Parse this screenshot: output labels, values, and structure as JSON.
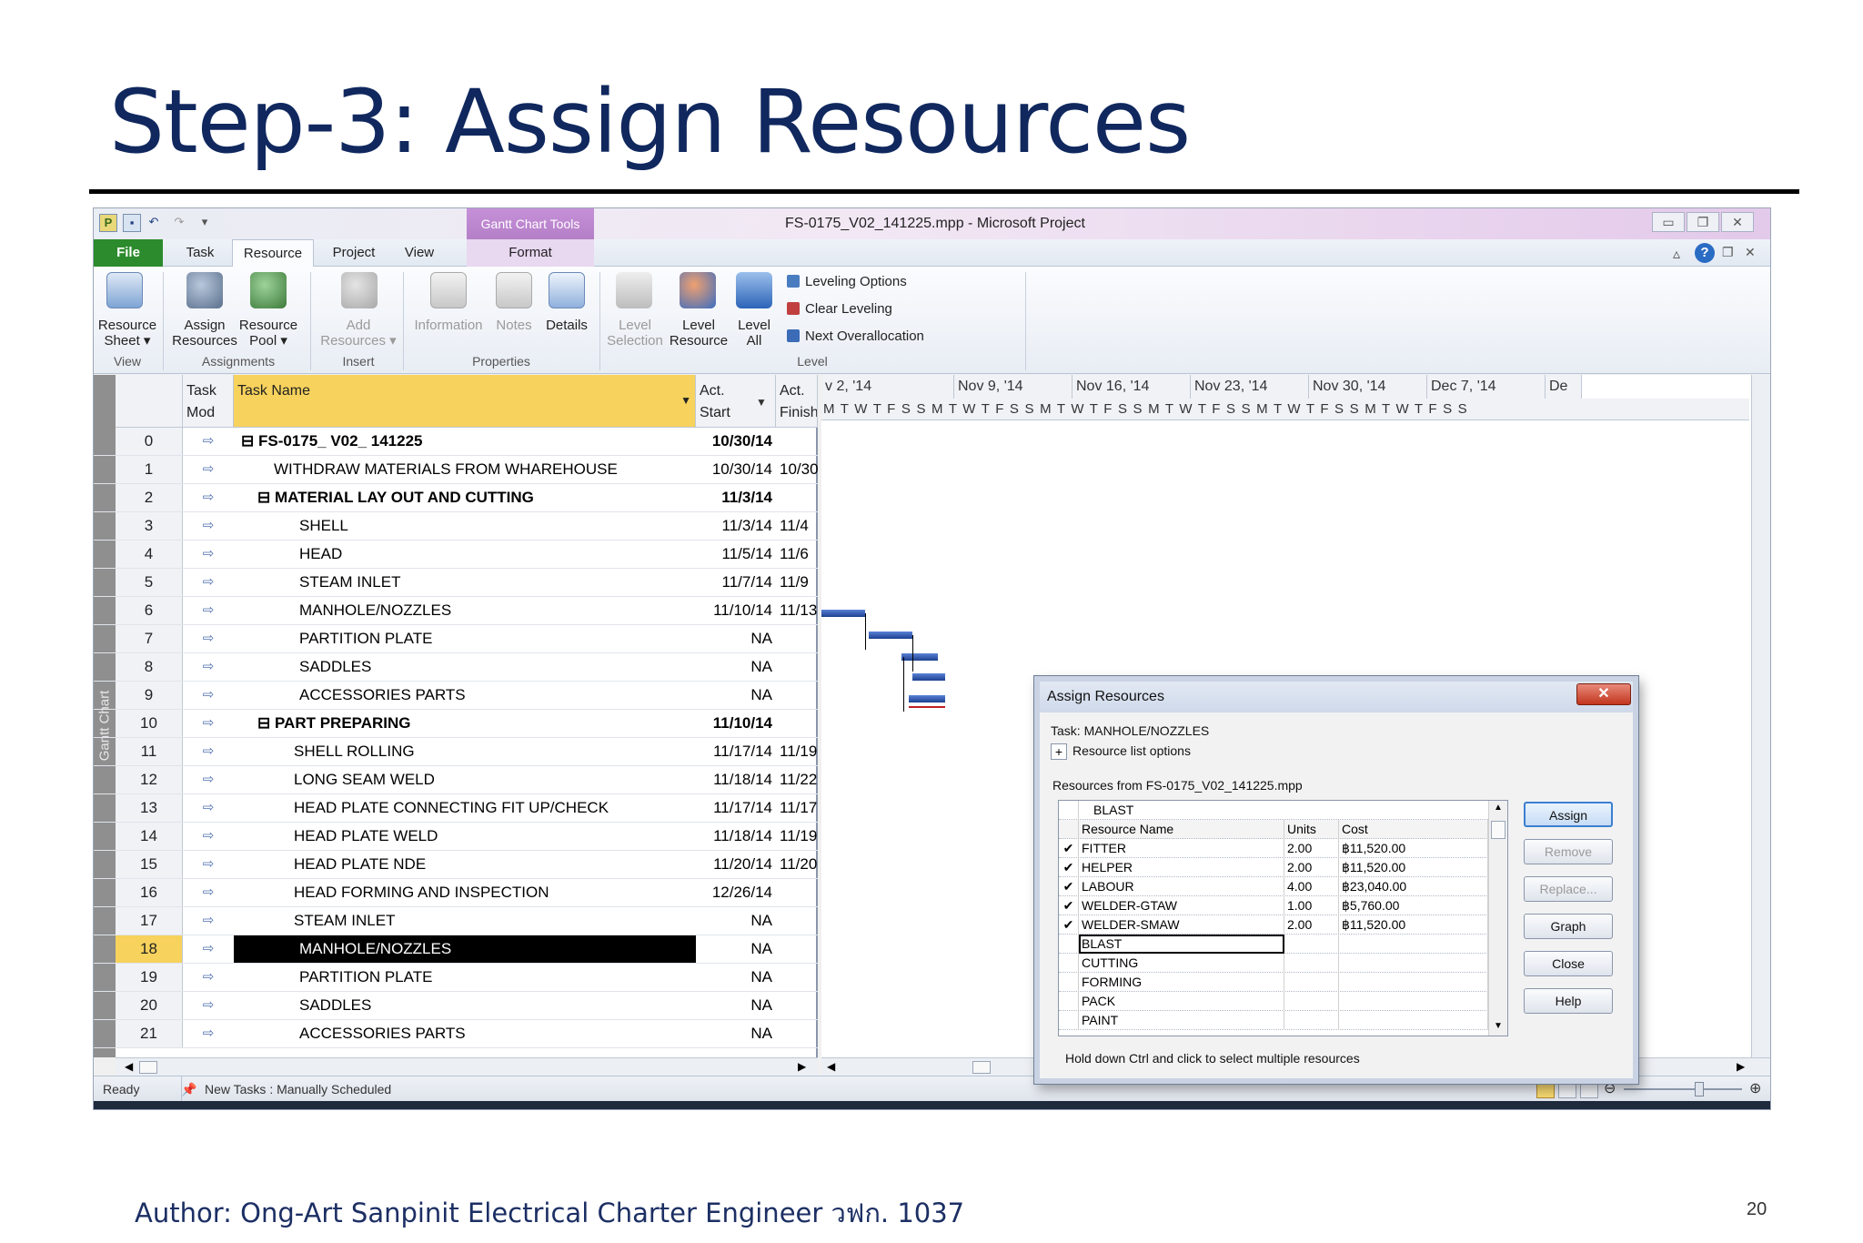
{
  "slide": {
    "title": "Step-3: Assign Resources",
    "author": "Author: Ong-Art Sanpinit Electrical Charter Engineer วฟก. 1037",
    "page_number": "20"
  },
  "window": {
    "title": "FS-0175_V02_141225.mpp - Microsoft Project",
    "context_tab": "Gantt Chart Tools"
  },
  "tabs": [
    "File",
    "Task",
    "Resource",
    "Project",
    "View",
    "Format"
  ],
  "ribbon": {
    "view": {
      "label": "View",
      "resource_sheet": "Resource\nSheet ▾"
    },
    "assignments": {
      "label": "Assignments",
      "assign": "Assign\nResources",
      "pool": "Resource\nPool ▾"
    },
    "insert": {
      "label": "Insert",
      "add": "Add\nResources ▾"
    },
    "properties": {
      "label": "Properties",
      "information": "Information",
      "notes": "Notes",
      "details": "Details"
    },
    "level": {
      "label": "Level",
      "selection": "Level\nSelection",
      "resource": "Level\nResource",
      "all": "Level\nAll",
      "options": "Leveling Options",
      "clear": "Clear Leveling",
      "next": "Next Overallocation"
    }
  },
  "grid": {
    "side_label": "Gantt Chart",
    "headers": {
      "mode": "Task\nMod",
      "name": "Task Name",
      "start": "Act.\nStart",
      "finish": "Act.\nFinish"
    },
    "rows": [
      {
        "id": "0",
        "name": "⊟ FS-0175_ V02_ 141225",
        "start": "10/30/14",
        "finish": "",
        "bold": true,
        "indent": 8
      },
      {
        "id": "1",
        "name": "WITHDRAW MATERIALS FROM WHAREHOUSE",
        "start": "10/30/14",
        "finish": "10/30",
        "bold": false,
        "indent": 44
      },
      {
        "id": "2",
        "name": "⊟ MATERIAL  LAY OUT  AND  CUTTING",
        "start": "11/3/14",
        "finish": "",
        "bold": true,
        "indent": 26
      },
      {
        "id": "3",
        "name": "SHELL",
        "start": "11/3/14",
        "finish": "11/4",
        "bold": false,
        "indent": 72
      },
      {
        "id": "4",
        "name": "HEAD",
        "start": "11/5/14",
        "finish": "11/6",
        "bold": false,
        "indent": 72
      },
      {
        "id": "5",
        "name": "STEAM  INLET",
        "start": "11/7/14",
        "finish": "11/9",
        "bold": false,
        "indent": 72
      },
      {
        "id": "6",
        "name": "MANHOLE/NOZZLES",
        "start": "11/10/14",
        "finish": "11/13",
        "bold": false,
        "indent": 72
      },
      {
        "id": "7",
        "name": "PARTITION  PLATE",
        "start": "NA",
        "finish": "",
        "bold": false,
        "indent": 72
      },
      {
        "id": "8",
        "name": "SADDLES",
        "start": "NA",
        "finish": "",
        "bold": false,
        "indent": 72
      },
      {
        "id": "9",
        "name": "ACCESSORIES  PARTS",
        "start": "NA",
        "finish": "",
        "bold": false,
        "indent": 72
      },
      {
        "id": "10",
        "name": "⊟ PART  PREPARING",
        "start": "11/10/14",
        "finish": "",
        "bold": true,
        "indent": 26
      },
      {
        "id": "11",
        "name": "SHELL  ROLLING",
        "start": "11/17/14",
        "finish": "11/19",
        "bold": false,
        "indent": 66
      },
      {
        "id": "12",
        "name": "LONG SEAM WELD",
        "start": "11/18/14",
        "finish": "11/22",
        "bold": false,
        "indent": 66
      },
      {
        "id": "13",
        "name": "HEAD PLATE CONNECTING  FIT UP/CHECK",
        "start": "11/17/14",
        "finish": "11/17",
        "bold": false,
        "indent": 66
      },
      {
        "id": "14",
        "name": "HEAD PLATE WELD",
        "start": "11/18/14",
        "finish": "11/19",
        "bold": false,
        "indent": 66
      },
      {
        "id": "15",
        "name": "HEAD PLATE NDE",
        "start": "11/20/14",
        "finish": "11/20",
        "bold": false,
        "indent": 66
      },
      {
        "id": "16",
        "name": "HEAD  FORMING  AND  INSPECTION",
        "start": "12/26/14",
        "finish": "",
        "bold": false,
        "indent": 66
      },
      {
        "id": "17",
        "name": "STEAM  INLET",
        "start": "NA",
        "finish": "",
        "bold": false,
        "indent": 66
      },
      {
        "id": "18",
        "name": "MANHOLE/NOZZLES",
        "start": "NA",
        "finish": "",
        "bold": false,
        "indent": 72,
        "selected": true
      },
      {
        "id": "19",
        "name": "PARTITION  PLATE",
        "start": "NA",
        "finish": "",
        "bold": false,
        "indent": 72
      },
      {
        "id": "20",
        "name": "SADDLES",
        "start": "NA",
        "finish": "",
        "bold": false,
        "indent": 72
      },
      {
        "id": "21",
        "name": "ACCESSORIES  PARTS",
        "start": "NA",
        "finish": "",
        "bold": false,
        "indent": 72
      }
    ]
  },
  "timeline": {
    "weeks": [
      "v 2, '14",
      "Nov 9, '14",
      "Nov 16, '14",
      "Nov 23, '14",
      "Nov 30, '14",
      "Dec 7, '14",
      "De"
    ],
    "days": "M T W T F S S M T W T F S S M T W T F S S M T W T F S S M T W T F S S M T W T F S S"
  },
  "dialog": {
    "title": "Assign Resources",
    "task": "Task:  MANHOLE/NOZZLES",
    "options": "Resource list options",
    "source": "Resources from FS-0175_V02_141225.mpp",
    "edit_value": "BLAST",
    "columns": {
      "name": "Resource Name",
      "units": "Units",
      "cost": "Cost"
    },
    "resources": [
      {
        "check": "✔",
        "name": "FITTER",
        "units": "2.00",
        "cost": "฿11,520.00"
      },
      {
        "check": "✔",
        "name": "HELPER",
        "units": "2.00",
        "cost": "฿11,520.00"
      },
      {
        "check": "✔",
        "name": "LABOUR",
        "units": "4.00",
        "cost": "฿23,040.00"
      },
      {
        "check": "✔",
        "name": "WELDER-GTAW",
        "units": "1.00",
        "cost": "฿5,760.00"
      },
      {
        "check": "✔",
        "name": "WELDER-SMAW",
        "units": "2.00",
        "cost": "฿11,520.00"
      },
      {
        "check": "",
        "name": "BLAST",
        "units": "",
        "cost": ""
      },
      {
        "check": "",
        "name": "CUTTING",
        "units": "",
        "cost": ""
      },
      {
        "check": "",
        "name": "FORMING",
        "units": "",
        "cost": ""
      },
      {
        "check": "",
        "name": "PACK",
        "units": "",
        "cost": ""
      },
      {
        "check": "",
        "name": "PAINT",
        "units": "",
        "cost": ""
      }
    ],
    "buttons": {
      "assign": "Assign",
      "remove": "Remove",
      "replace": "Replace...",
      "graph": "Graph",
      "close": "Close",
      "help": "Help"
    },
    "hint": "Hold down Ctrl and click to select multiple resources"
  },
  "status": {
    "ready": "Ready",
    "new_tasks": "New Tasks : Manually Scheduled"
  },
  "colors": {
    "title": "#10285e",
    "file_tab": "#2c8b2c",
    "selected_row": "#f7d25c",
    "gantt_bar": "#1c3f90",
    "baseline": "#c02020"
  }
}
